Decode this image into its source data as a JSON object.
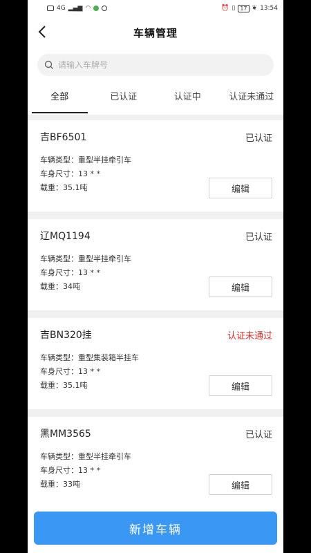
{
  "statusbar": {
    "time": "13:54",
    "signal": "4G",
    "battery": "17"
  },
  "header": {
    "title": "车辆管理"
  },
  "search": {
    "placeholder": "请输入车牌号"
  },
  "tabs": [
    {
      "label": "全部"
    },
    {
      "label": "已认证"
    },
    {
      "label": "认证中"
    },
    {
      "label": "认证未通过"
    }
  ],
  "vehicles": [
    {
      "plate": "吉BF6501",
      "status": "已认证",
      "type": "车辆类型：重型半挂牵引车",
      "size": "车身尺寸：13 * *",
      "load": "载重：35.1吨",
      "edit": "编辑"
    },
    {
      "plate": "辽MQ1194",
      "status": "已认证",
      "type": "车辆类型：重型半挂牵引车",
      "size": "车身尺寸：13 * *",
      "load": "载重：34吨",
      "edit": "编辑"
    },
    {
      "plate": "吉BN320挂",
      "status": "认证未通过",
      "type": "车辆类型：重型集装箱半挂车",
      "size": "车身尺寸：13 * *",
      "load": "载重：35.1吨",
      "edit": "编辑"
    },
    {
      "plate": "黑MM3565",
      "status": "已认证",
      "type": "车辆类型：重型半挂牵引车",
      "size": "车身尺寸：13 * *",
      "load": "载重：33吨",
      "edit": "编辑"
    }
  ],
  "colors": {
    "accent": "#3a97f3",
    "fail": "#d0322c"
  },
  "footer": {
    "add_label": "新增车辆"
  }
}
